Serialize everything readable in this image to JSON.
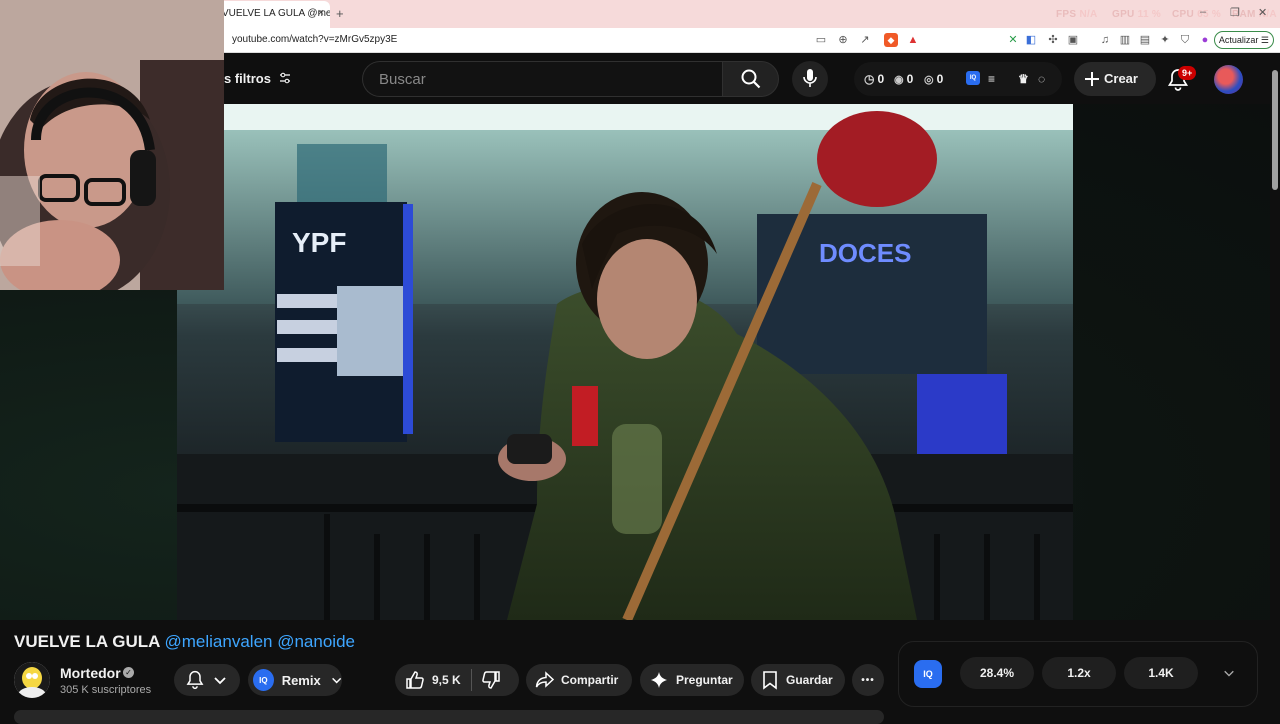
{
  "browser": {
    "tab_title": "VUELVE LA GULA @melianvalen",
    "tab_close": "×",
    "new_tab": "+",
    "url": "youtube.com/watch?v=zMrGv5zpy3E",
    "overlay_stats": [
      {
        "label": "FPS",
        "value": "N/A"
      },
      {
        "label": "GPU",
        "value": "11 %"
      },
      {
        "label": "CPU",
        "value": "65 %"
      },
      {
        "label": "RAM",
        "value": "N/A"
      }
    ],
    "update_button": "Actualizar",
    "window_controls": [
      "–",
      "❐",
      "✕"
    ]
  },
  "masthead": {
    "filters_label": "s filtros",
    "search_placeholder": "Buscar",
    "counters": [
      "0",
      "0",
      "0"
    ],
    "create_label": "Crear",
    "notif_badge": "9+",
    "iq_label": "IQ"
  },
  "video": {
    "title": "VUELVE LA GULA",
    "mentions": [
      "@melianvalen",
      "@nanoide"
    ],
    "scene_signs": [
      "YPF",
      "DOCES"
    ]
  },
  "channel": {
    "name": "Mortedor",
    "subscribers": "305 K suscriptores"
  },
  "actions": {
    "remix": "Remix",
    "likes": "9,5 K",
    "share": "Compartir",
    "ask": "Preguntar",
    "save": "Guardar",
    "more": "•••"
  },
  "stats": {
    "values": [
      "28.4%",
      "1.2x",
      "1.4K"
    ]
  }
}
